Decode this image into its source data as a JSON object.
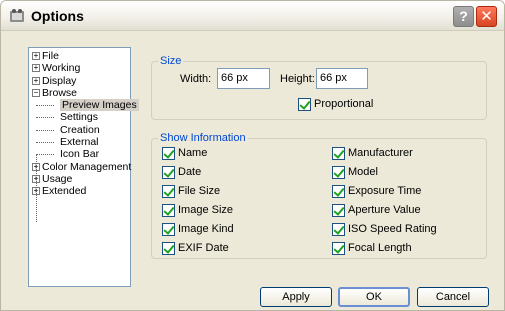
{
  "window": {
    "title": "Options"
  },
  "tree": {
    "top": [
      {
        "label": "File",
        "expander": "+"
      },
      {
        "label": "Working",
        "expander": "+"
      },
      {
        "label": "Display",
        "expander": "+"
      },
      {
        "label": "Browse",
        "expander": "−"
      }
    ],
    "children": [
      {
        "label": "Preview Images",
        "selected": true
      },
      {
        "label": "Settings"
      },
      {
        "label": "Creation"
      },
      {
        "label": "External"
      },
      {
        "label": "Icon Bar"
      }
    ],
    "bottom": [
      {
        "label": "Color Management",
        "expander": "+"
      },
      {
        "label": "Usage",
        "expander": "+"
      },
      {
        "label": "Extended",
        "expander": "+"
      }
    ]
  },
  "size": {
    "legend": "Size",
    "width_label": "Width:",
    "width_value": "66 px",
    "height_label": "Height:",
    "height_value": "66 px",
    "proportional_label": "Proportional"
  },
  "show_info": {
    "legend": "Show Information",
    "left": [
      "Name",
      "Date",
      "File Size",
      "Image Size",
      "Image Kind",
      "EXIF Date"
    ],
    "right": [
      "Manufacturer",
      "Model",
      "Exposure Time",
      "Aperture Value",
      "ISO Speed Rating",
      "Focal Length"
    ]
  },
  "buttons": {
    "apply": "Apply",
    "ok": "OK",
    "cancel": "Cancel"
  }
}
